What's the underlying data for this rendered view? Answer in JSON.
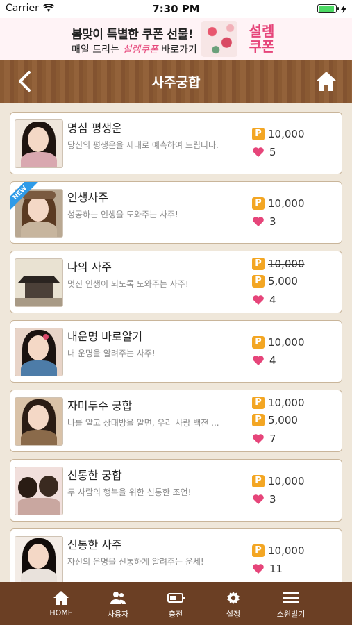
{
  "status": {
    "carrier": "Carrier",
    "time": "7:30 PM"
  },
  "banner": {
    "line1": "봄맞이 특별한 쿠폰 선물!",
    "line2_pre": "매일 드리는 ",
    "line2_brand": "설렘쿠폰",
    "line2_post": " 바로가기",
    "logo_text": "설렘 쿠폰"
  },
  "header": {
    "title": "사주궁합"
  },
  "items": [
    {
      "title": "명심 평생운",
      "desc": "당신의 평생운을 제대로 예측하여 드립니다.",
      "price": "10,000",
      "old_price": "",
      "likes": "5",
      "new": false
    },
    {
      "title": "인생사주",
      "desc": "성공하는 인생을 도와주는 사주!",
      "price": "10,000",
      "old_price": "",
      "likes": "3",
      "new": true,
      "new_label": "NEW"
    },
    {
      "title": "나의 사주",
      "desc": "멋진 인생이 되도록 도와주는 사주!",
      "price": "5,000",
      "old_price": "10,000",
      "likes": "4",
      "new": false
    },
    {
      "title": "내운명 바로알기",
      "desc": "내 운명을 알려주는 사주!",
      "price": "10,000",
      "old_price": "",
      "likes": "4",
      "new": false
    },
    {
      "title": "자미두수 궁합",
      "desc": "나를 알고 상대방을 알면, 우리 사랑 백전 ...",
      "price": "5,000",
      "old_price": "10,000",
      "likes": "7",
      "new": false
    },
    {
      "title": "신통한 궁합",
      "desc": "두 사람의 행복을 위한 신통한 조언!",
      "price": "10,000",
      "old_price": "",
      "likes": "3",
      "new": false
    },
    {
      "title": "신통한 사주",
      "desc": "자신의 운명을 신통하게 알려주는 운세!",
      "price": "10,000",
      "old_price": "",
      "likes": "11",
      "new": false
    }
  ],
  "tabs": [
    {
      "label": "HOME",
      "icon": "home-icon"
    },
    {
      "label": "사용자",
      "icon": "users-icon"
    },
    {
      "label": "충전",
      "icon": "battery-icon"
    },
    {
      "label": "설정",
      "icon": "gear-icon"
    },
    {
      "label": "소원빌기",
      "icon": "menu-icon"
    }
  ],
  "colors": {
    "brand_brown": "#8a5a33",
    "tabbar": "#6b3f24",
    "point_badge": "#f3a623",
    "heart": "#e6457a",
    "accent_pink": "#e6457a"
  }
}
